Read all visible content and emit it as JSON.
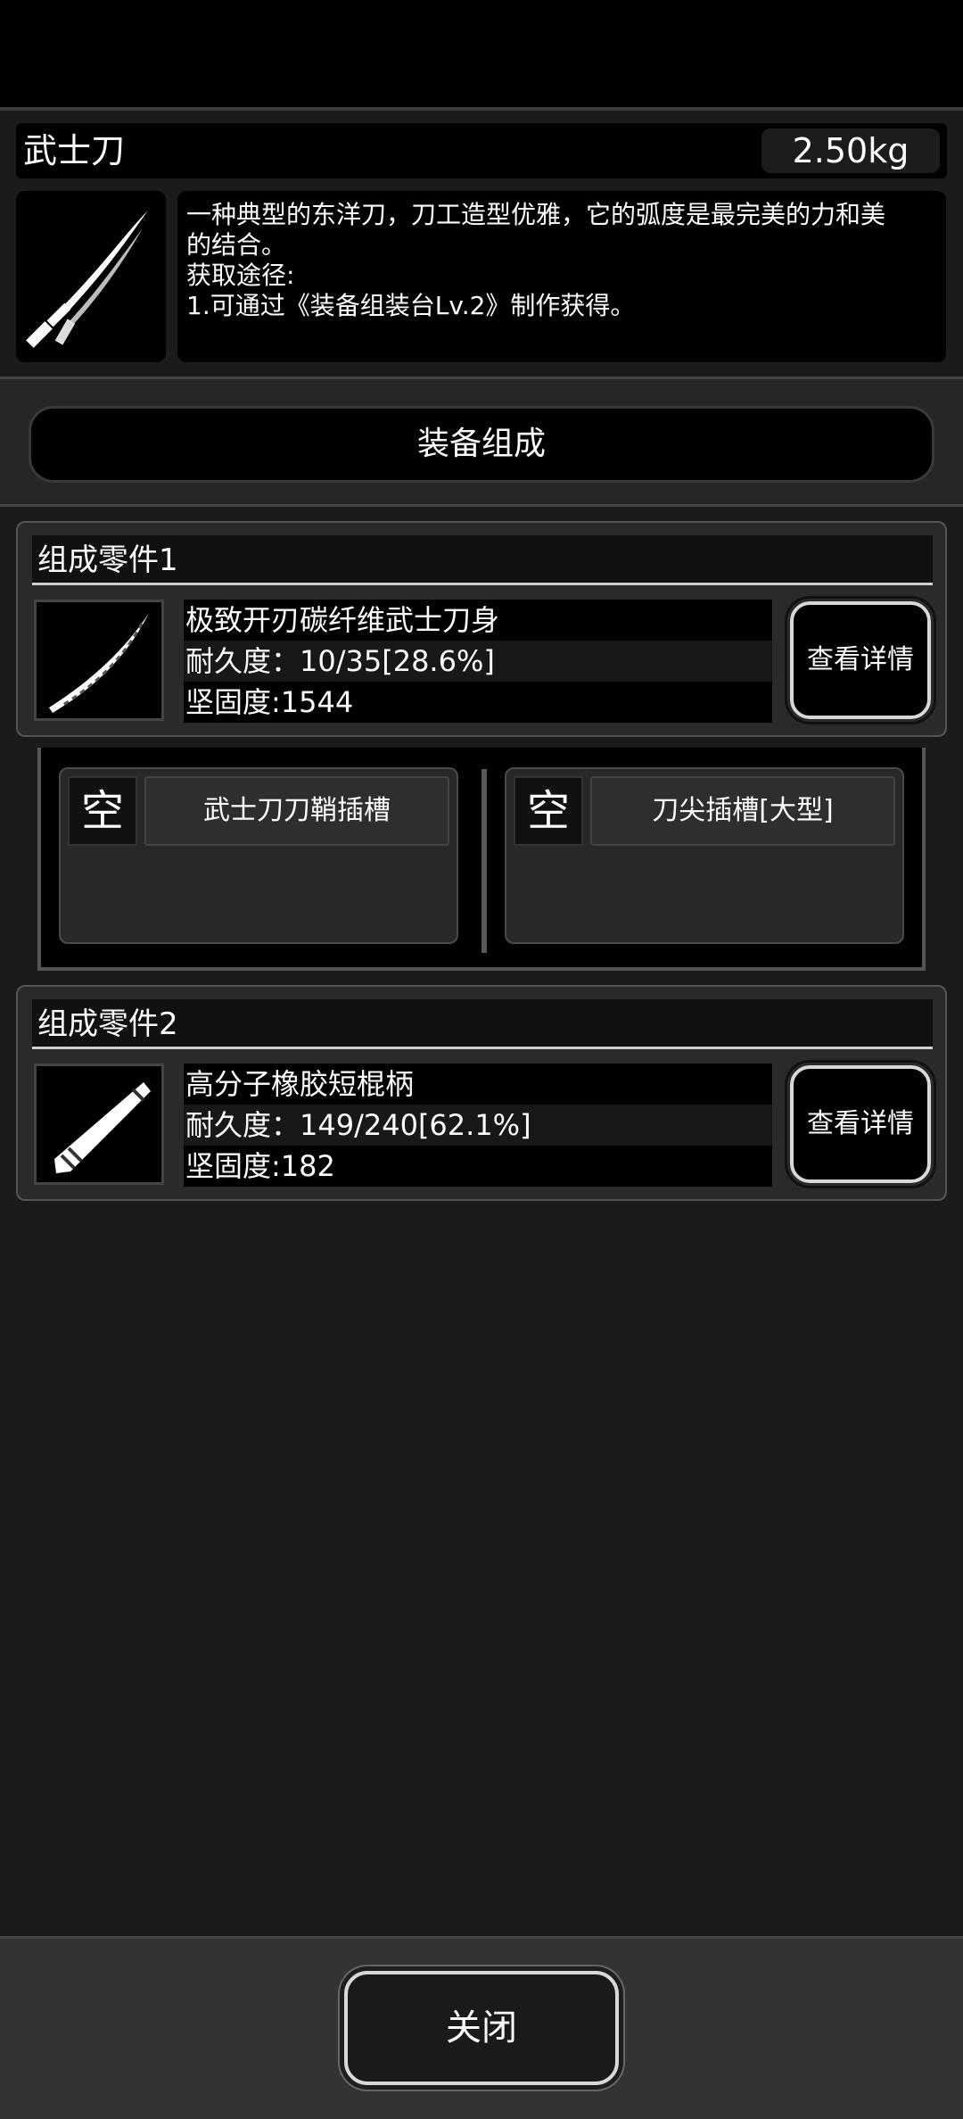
{
  "item": {
    "name": "武士刀",
    "weight": "2.50kg",
    "icon": "katana-icon",
    "description_lines": [
      "一种典型的东洋刀，刀工造型优雅，它的弧度是最完美的力和美",
      "的结合。",
      "获取途径:",
      "1.可通过《装备组装台Lv.2》制作获得。"
    ]
  },
  "compose_button": "装备组成",
  "parts": [
    {
      "header": "组成零件1",
      "icon": "blade-icon",
      "name": "极致开刃碳纤维武士刀身",
      "durability": "耐久度：10/35[28.6%]",
      "hardness": "坚固度:1544",
      "detail_button": "查看详情"
    },
    {
      "header": "组成零件2",
      "icon": "handle-icon",
      "name": "高分子橡胶短棍柄",
      "durability": "耐久度：149/240[62.1%]",
      "hardness": "坚固度:182",
      "detail_button": "查看详情"
    }
  ],
  "slots": [
    {
      "status": "空",
      "name": "武士刀刀鞘插槽"
    },
    {
      "status": "空",
      "name": "刀尖插槽[大型]"
    }
  ],
  "close_button": "关闭"
}
